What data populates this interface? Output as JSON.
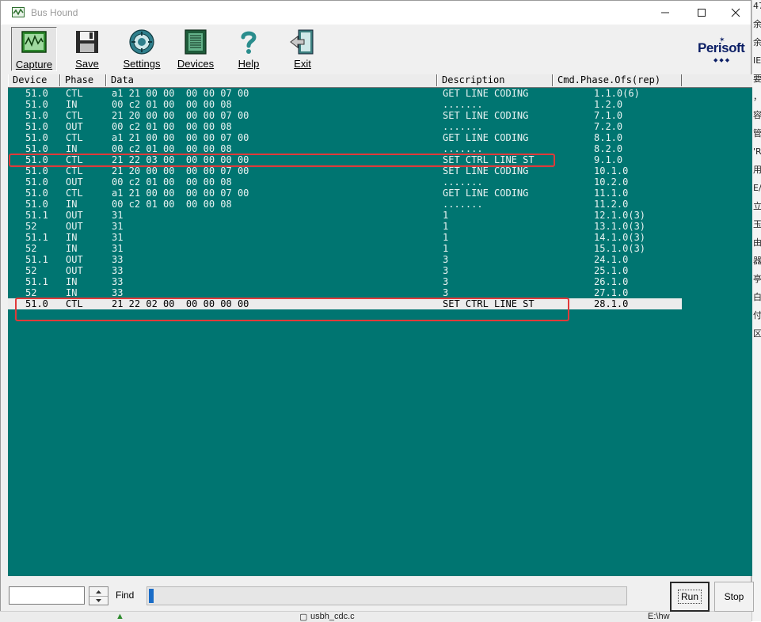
{
  "window": {
    "title": "Bus Hound"
  },
  "toolbar": {
    "capture": "Capture",
    "save": "Save",
    "settings": "Settings",
    "devices": "Devices",
    "help": "Help",
    "exit": "Exit",
    "logo": "Perisoft"
  },
  "columns": {
    "device": "Device",
    "phase": "Phase",
    "data": "Data",
    "description": "Description",
    "cmd": "Cmd.Phase.Ofs(rep)"
  },
  "rows": [
    {
      "device": "51.0",
      "phase": "CTL",
      "data": "a1 21 00 00  00 00 07 00",
      "desc": "GET LINE CODING",
      "cmd": "1.1.0(6)"
    },
    {
      "device": "51.0",
      "phase": "IN",
      "data": "00 c2 01 00  00 00 08",
      "desc": ".......",
      "cmd": "1.2.0"
    },
    {
      "device": "51.0",
      "phase": "CTL",
      "data": "21 20 00 00  00 00 07 00",
      "desc": "SET LINE CODING",
      "cmd": "7.1.0"
    },
    {
      "device": "51.0",
      "phase": "OUT",
      "data": "00 c2 01 00  00 00 08",
      "desc": ".......",
      "cmd": "7.2.0"
    },
    {
      "device": "51.0",
      "phase": "CTL",
      "data": "a1 21 00 00  00 00 07 00",
      "desc": "GET LINE CODING",
      "cmd": "8.1.0"
    },
    {
      "device": "51.0",
      "phase": "IN",
      "data": "00 c2 01 00  00 00 08",
      "desc": ".......",
      "cmd": "8.2.0"
    },
    {
      "device": "51.0",
      "phase": "CTL",
      "data": "21 22 03 00  00 00 00 00",
      "desc": "SET CTRL LINE ST",
      "cmd": "9.1.0"
    },
    {
      "device": "51.0",
      "phase": "CTL",
      "data": "21 20 00 00  00 00 07 00",
      "desc": "SET LINE CODING",
      "cmd": "10.1.0"
    },
    {
      "device": "51.0",
      "phase": "OUT",
      "data": "00 c2 01 00  00 00 08",
      "desc": ".......",
      "cmd": "10.2.0"
    },
    {
      "device": "51.0",
      "phase": "CTL",
      "data": "a1 21 00 00  00 00 07 00",
      "desc": "GET LINE CODING",
      "cmd": "11.1.0"
    },
    {
      "device": "51.0",
      "phase": "IN",
      "data": "00 c2 01 00  00 00 08",
      "desc": ".......",
      "cmd": "11.2.0"
    },
    {
      "device": "51.1",
      "phase": "OUT",
      "data": "31",
      "desc": "1",
      "cmd": "12.1.0(3)"
    },
    {
      "device": "52",
      "phase": "OUT",
      "data": "31",
      "desc": "1",
      "cmd": "13.1.0(3)"
    },
    {
      "device": "51.1",
      "phase": "IN",
      "data": "31",
      "desc": "1",
      "cmd": "14.1.0(3)"
    },
    {
      "device": "52",
      "phase": "IN",
      "data": "31",
      "desc": "1",
      "cmd": "15.1.0(3)"
    },
    {
      "device": "51.1",
      "phase": "OUT",
      "data": "33",
      "desc": "3",
      "cmd": "24.1.0"
    },
    {
      "device": "52",
      "phase": "OUT",
      "data": "33",
      "desc": "3",
      "cmd": "25.1.0"
    },
    {
      "device": "51.1",
      "phase": "IN",
      "data": "33",
      "desc": "3",
      "cmd": "26.1.0"
    },
    {
      "device": "52",
      "phase": "IN",
      "data": "33",
      "desc": "3",
      "cmd": "27.1.0"
    },
    {
      "device": "51.0",
      "phase": "CTL",
      "data": "21 22 02 00  00 00 00 00",
      "desc": "SET CTRL LINE ST",
      "cmd": "28.1.0",
      "selected": true
    }
  ],
  "bottom": {
    "find_value": "",
    "find_label": "Find",
    "progress": 0.01,
    "run": "Run",
    "stop": "Stop"
  },
  "background": {
    "edge_chars": [
      "47",
      "余",
      "余",
      "IE",
      "要",
      "，",
      "容",
      "管",
      "'R",
      "用",
      "E/",
      "立",
      "玉",
      "由",
      "器",
      "亭",
      "白",
      "付",
      "区"
    ],
    "taskbar_file": "usbh_cdc.c",
    "taskbar_path": "E:\\hw"
  },
  "colors": {
    "list_bg": "#007571",
    "row_text": "#e9f4f3",
    "highlight_box": "#e03a3a",
    "logo": "#0c1f66"
  }
}
